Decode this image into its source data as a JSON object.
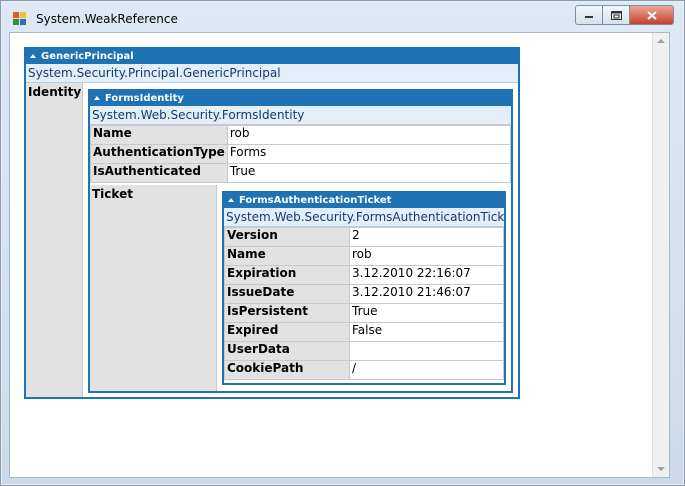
{
  "window": {
    "title": "System.WeakReference"
  },
  "root": {
    "header": "GenericPrincipal",
    "type": "System.Security.Principal.GenericPrincipal",
    "key": "Identity"
  },
  "identity": {
    "header": "FormsIdentity",
    "type": "System.Web.Security.FormsIdentity",
    "rows": [
      {
        "key": "Name",
        "value": "rob"
      },
      {
        "key": "AuthenticationType",
        "value": "Forms"
      },
      {
        "key": "IsAuthenticated",
        "value": "True"
      }
    ],
    "ticket_key": "Ticket"
  },
  "ticket": {
    "header": "FormsAuthenticationTicket",
    "type": "System.Web.Security.FormsAuthenticationTicket",
    "rows": [
      {
        "key": "Version",
        "value": "2"
      },
      {
        "key": "Name",
        "value": "rob"
      },
      {
        "key": "Expiration",
        "value": "3.12.2010 22:16:07"
      },
      {
        "key": "IssueDate",
        "value": "3.12.2010 21:46:07"
      },
      {
        "key": "IsPersistent",
        "value": "True"
      },
      {
        "key": "Expired",
        "value": "False"
      },
      {
        "key": "UserData",
        "value": ""
      },
      {
        "key": "CookiePath",
        "value": "/"
      }
    ]
  },
  "colors": {
    "accent": "#1f73b5",
    "key_bg": "#e2e2e2",
    "type_bg": "#e4eef8"
  },
  "icons": {
    "app": "app-icon",
    "minimize": "minimize-icon",
    "maximize": "maximize-icon",
    "close": "close-icon"
  }
}
